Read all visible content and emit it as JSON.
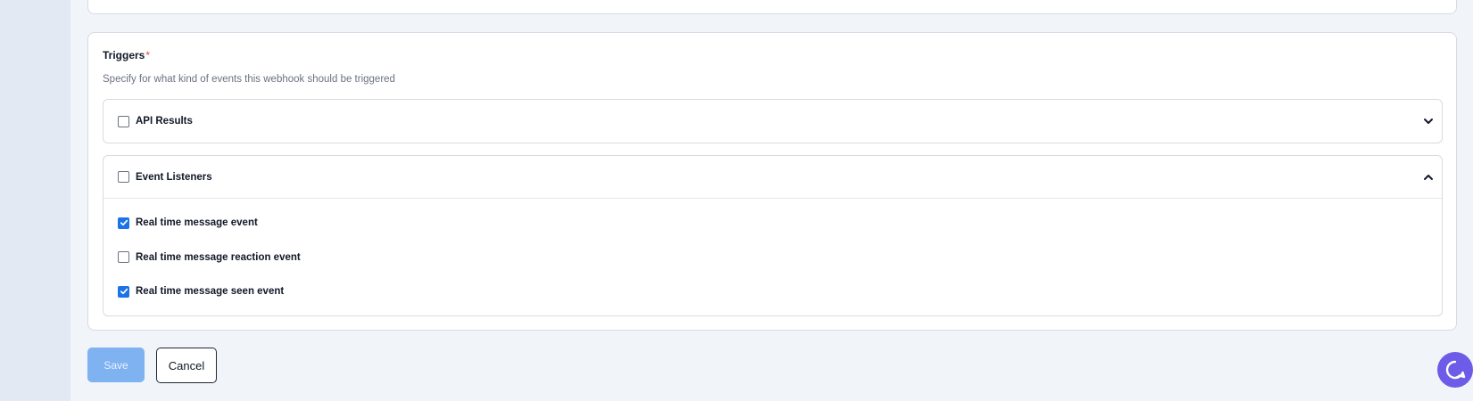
{
  "triggers": {
    "title": "Triggers",
    "required_mark": "*",
    "description": "Specify for what kind of events this webhook should be triggered",
    "groups": [
      {
        "label": "API Results",
        "checked": false,
        "expanded": false,
        "chevron_icon": "chevron-down-icon"
      },
      {
        "label": "Event Listeners",
        "checked": false,
        "expanded": true,
        "chevron_icon": "chevron-up-icon",
        "options": [
          {
            "label": "Real time message event",
            "checked": true
          },
          {
            "label": "Real time message reaction event",
            "checked": false
          },
          {
            "label": "Real time message seen event",
            "checked": true
          }
        ]
      }
    ]
  },
  "actions": {
    "save_label": "Save",
    "cancel_label": "Cancel"
  },
  "chat_widget": {
    "icon": "chat-bubble-icon",
    "color": "#6c5ce7"
  },
  "colors": {
    "accent": "#1a73e8",
    "save_disabled": "#7fb2f0",
    "required": "#ef4444"
  }
}
